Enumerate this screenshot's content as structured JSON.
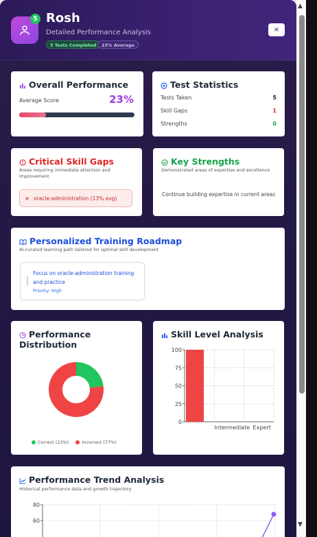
{
  "header": {
    "name": "Rosh",
    "subtitle": "Detailed Performance Analysis",
    "badge_count": "5",
    "pill_tests": "5 Tests Completed",
    "pill_average": "23% Average",
    "close_label": "×"
  },
  "overall": {
    "title": "Overall Performance",
    "avg_label": "Average Score",
    "avg_value": "23%",
    "progress": 0.23
  },
  "stats": {
    "title": "Test Statistics",
    "rows": [
      {
        "label": "Tests Taken",
        "value": "5",
        "color": "#222222"
      },
      {
        "label": "Skill Gaps",
        "value": "1",
        "color": "#dc2626"
      },
      {
        "label": "Strengths",
        "value": "0",
        "color": "#16a34a"
      }
    ]
  },
  "gaps": {
    "title": "Critical Skill Gaps",
    "subtitle": "Areas requiring immediate attention and improvement",
    "item": "oracle-administration (13% avg)"
  },
  "strengths": {
    "title": "Key Strengths",
    "subtitle": "Demonstrated areas of expertise and excellence",
    "empty": "Continue building expertise in current areas"
  },
  "roadmap": {
    "title": "Personalized Training Roadmap",
    "subtitle": "AI-curated learning path tailored for optimal skill development",
    "item_title": "Focus on oracle-administration training and practice",
    "item_priority": "Priority: High"
  },
  "distribution": {
    "title": "Performance Distribution",
    "legend_correct": "Correct (23%)",
    "legend_incorrect": "Incorrect (77%)",
    "correct_color": "#22c55e",
    "incorrect_color": "#ef4444"
  },
  "skill_level": {
    "title": "Skill Level Analysis"
  },
  "trend": {
    "title": "Performance Trend Analysis",
    "subtitle": "Historical performance data and growth trajectory"
  },
  "chart_data": [
    {
      "type": "pie",
      "title": "Performance Distribution",
      "labels": [
        "Correct",
        "Incorrect"
      ],
      "values": [
        23,
        77
      ]
    },
    {
      "type": "bar",
      "title": "Skill Level Analysis",
      "categories": [
        "",
        "Intermediate",
        "Expert"
      ],
      "values": [
        100,
        0,
        0
      ],
      "ylim": [
        0,
        100
      ],
      "yticks": [
        0,
        25,
        50,
        75,
        100
      ],
      "grid": true
    },
    {
      "type": "line",
      "title": "Performance Trend Analysis",
      "yticks": [
        60,
        80
      ],
      "visible_points": [
        {
          "y": 68
        }
      ],
      "grid": true
    }
  ]
}
